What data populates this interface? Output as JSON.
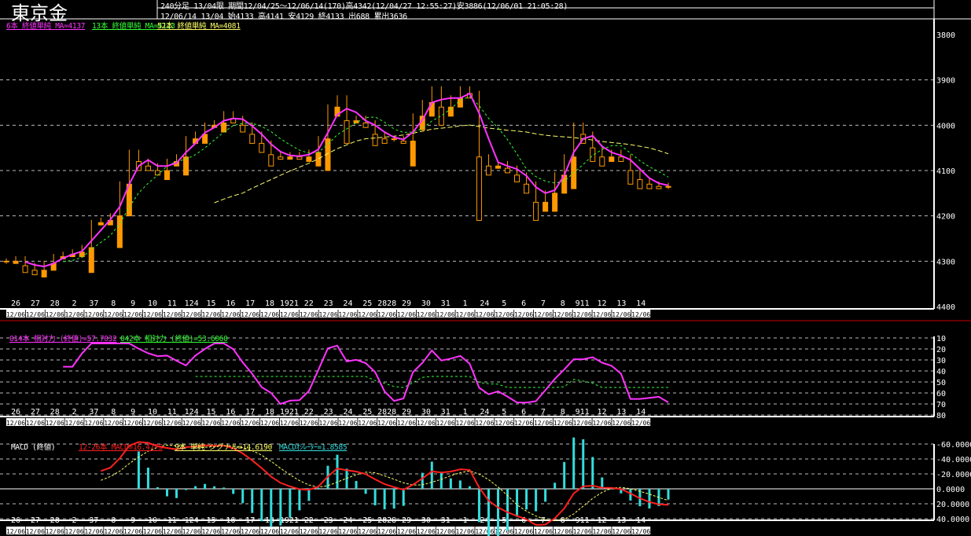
{
  "header": {
    "title": "東京金",
    "line1": "240分足 13/04限 期間12/04/25〜12/06/14(170)高4342(12/04/27 12:55:27)安3886(12/06/01 21:05:28)",
    "line2": "12/06/14 13/04 始4133 高4141 安4129 終4133 出688 累出3636"
  },
  "price_panel": {
    "legend": [
      {
        "text": "6本 終値単純 MA=4137",
        "color": "#ff33ff"
      },
      {
        "text": "13本 終値単純 MA=4123",
        "color": "#33ff33"
      },
      {
        "text": "52本 終値単純 MA=4081",
        "color": "#ffff66"
      }
    ],
    "y_ticks": [
      4400,
      4300,
      4200,
      4100,
      4000,
      3900,
      3800
    ]
  },
  "rsi_panel": {
    "legend": [
      {
        "text": "014本 相対力 (終値)=57.7032",
        "color": "#ff33ff"
      },
      {
        "text": "042本 相対力 (終値)=53.6060",
        "color": "#33ff33"
      }
    ],
    "y_ticks": [
      80,
      70,
      60,
      50,
      40,
      30,
      20,
      10
    ]
  },
  "macd_panel": {
    "legend": [
      {
        "text": "MACD (終値)",
        "color": "#ffffff"
      },
      {
        "text": "12-26本 MACD=16.4775",
        "color": "#ff2020"
      },
      {
        "text": "9本 単純 シグナル=14.6190",
        "color": "#ffff66"
      },
      {
        "text": "MACDｵｼﾚｰﾀｰ=1.8585",
        "color": "#33dddd"
      }
    ],
    "y_ticks": [
      "40.0000",
      "20.0000",
      "0.0000",
      "-20.0000",
      "-40.0000",
      "-60.0000"
    ]
  },
  "chart_data": {
    "type": "candlestick",
    "x_labels": [
      "26",
      "27",
      "28",
      "2",
      "37",
      "8",
      "9",
      "10",
      "11",
      "124",
      "15",
      "16",
      "17",
      "18",
      "1921",
      "22",
      "23",
      "24",
      "25",
      "2828",
      "29",
      "30",
      "31",
      "1",
      "24",
      "5",
      "6",
      "7",
      "8",
      "911",
      "12",
      "13",
      "14"
    ],
    "close": [
      4300,
      4295,
      4310,
      4320,
      4305,
      4290,
      4285,
      4280,
      4270,
      4215,
      4210,
      4200,
      4130,
      4060,
      4080,
      4090,
      4100,
      4080,
      4070,
      4030,
      4020,
      4000,
      3995,
      3975,
      3985,
      4000,
      4020,
      4040,
      4065,
      4070,
      4065,
      4070,
      4060,
      4030,
      3960,
      3940,
      3990,
      3985,
      3995,
      4020,
      4030,
      4030,
      4035,
      3980,
      3950,
      3920,
      3960,
      3940,
      3920,
      3930,
      4070,
      4090,
      4085,
      4095,
      4110,
      4130,
      4170,
      4150,
      4110,
      4070,
      4000,
      4020,
      4050,
      4070,
      4060,
      4070,
      4100,
      4120,
      4130,
      4135,
      4133
    ],
    "price_range": [
      3800,
      4400
    ],
    "rsi_range": [
      10,
      80
    ],
    "macd_range": [
      -60,
      40
    ],
    "colors": {
      "candle": "#ff9900",
      "ma6": "#ff33ff",
      "ma13": "#33ff33",
      "ma52": "#ffff66",
      "macd": "#ff2020",
      "signal": "#ffff66",
      "osc": "#33dddd"
    }
  }
}
